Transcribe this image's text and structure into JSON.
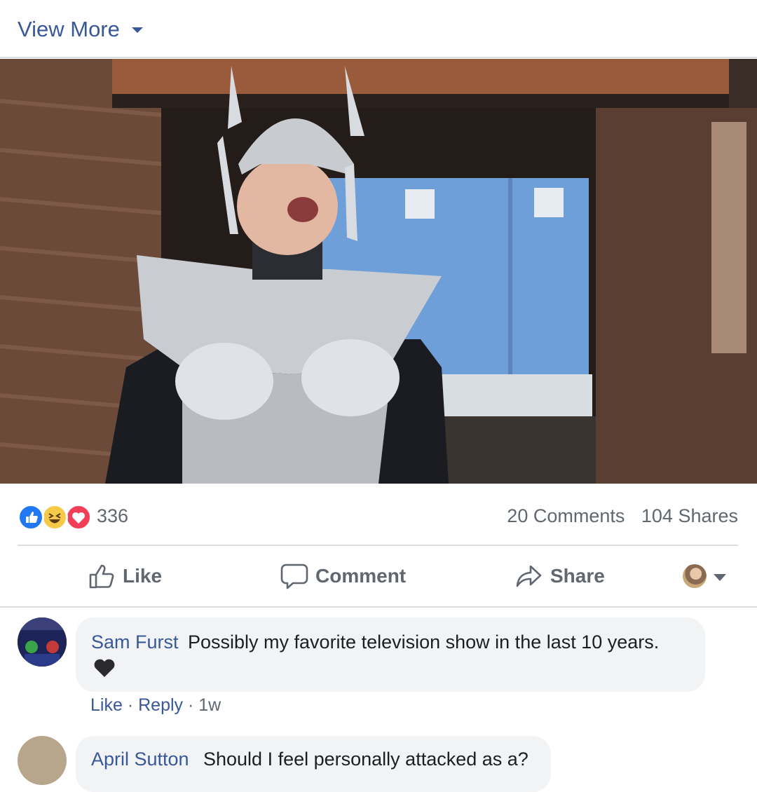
{
  "header": {
    "view_more": "View More"
  },
  "media": {
    "description_icon": "video-still"
  },
  "reactions": {
    "icons": [
      "like-icon",
      "haha-icon",
      "love-icon"
    ],
    "count": "336",
    "comments": "20 Comments",
    "shares": "104 Shares"
  },
  "actions": {
    "like": "Like",
    "comment": "Comment",
    "share": "Share"
  },
  "comments": [
    {
      "author": "Sam Furst",
      "text": "Possibly my favorite television show in the last 10 years.",
      "like": "Like",
      "reply": "Reply",
      "time": "1w"
    },
    {
      "author": "April Sutton",
      "text": "Should I feel personally attacked as a?"
    }
  ],
  "colors": {
    "link": "#385898",
    "text": "#1c1e21",
    "secondary": "#606770",
    "like_blue": "#2078f4",
    "love_red": "#f33e58",
    "haha_yellow": "#f7c948"
  }
}
